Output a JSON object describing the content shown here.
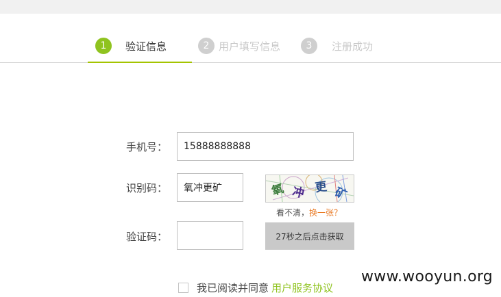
{
  "steps": [
    {
      "number": "1",
      "label": "验证信息",
      "active": true
    },
    {
      "number": "2",
      "label": "用户填写信息",
      "active": false
    },
    {
      "number": "3",
      "label": "注册成功",
      "active": false
    }
  ],
  "form": {
    "phone_label": "手机号：",
    "phone_value": "15888888888",
    "captcha_label": "识别码：",
    "captcha_value": "氧冲更矿",
    "captcha_image_chars": [
      "氧",
      "冲",
      "更",
      "矿"
    ],
    "captcha_refresh_prefix": "看不清，",
    "captcha_refresh_link": "换一张？",
    "sms_code_label": "验证码：",
    "sms_code_value": "",
    "sms_button_label": "27秒之后点击获取"
  },
  "agreement": {
    "text": "我已阅读并同意",
    "link": "用户服务协议",
    "checked": false
  },
  "watermark": "www.wooyun.org",
  "colors": {
    "accent_green": "#8fc31f",
    "link_orange": "#e8761e",
    "inactive_step": "#cfcfcf",
    "disabled_button": "#c9c9c9"
  }
}
